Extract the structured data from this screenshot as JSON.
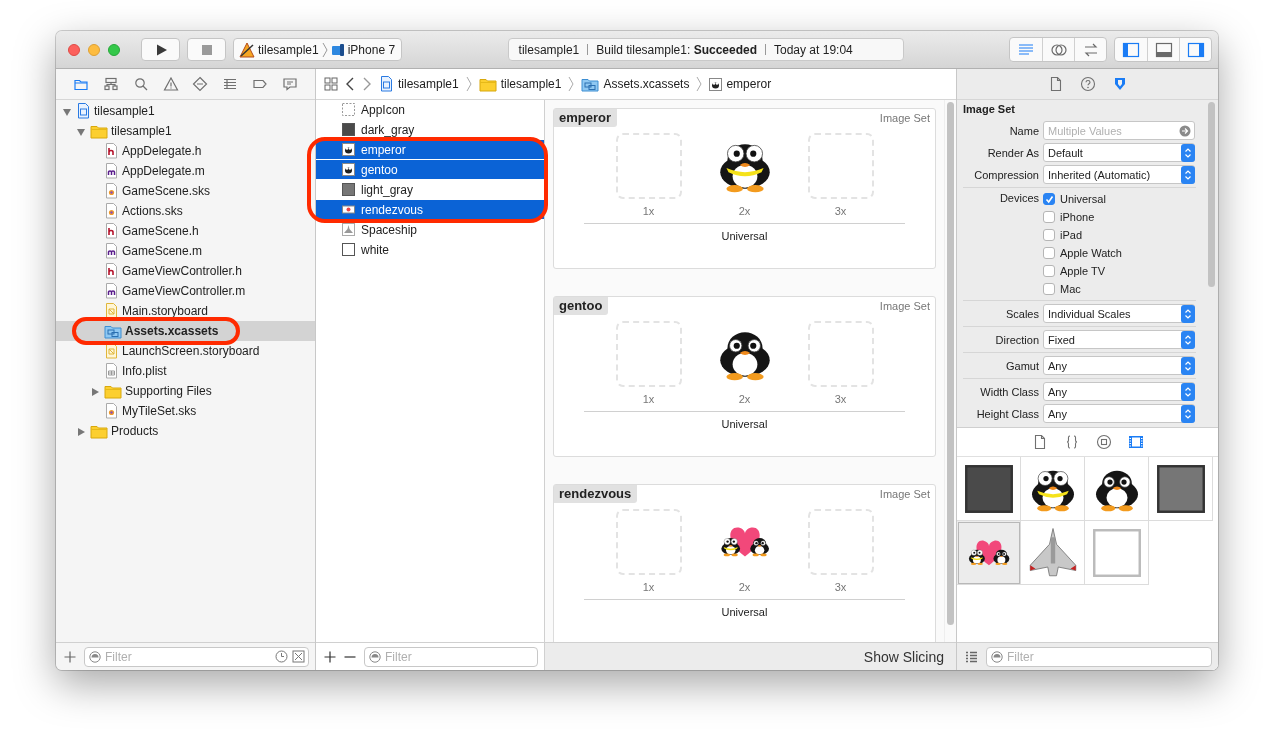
{
  "toolbar": {
    "scheme": {
      "target": "tilesample1",
      "device": "iPhone 7"
    },
    "activity": {
      "project": "tilesample1",
      "status": "Build tilesample1: **Succeeded**",
      "time": "Today at 19:04"
    },
    "editor_modes": [
      {
        "kind": "standard",
        "selected": true
      },
      {
        "kind": "assistant",
        "selected": false
      },
      {
        "kind": "version",
        "selected": false
      }
    ],
    "panels": [
      {
        "kind": "navigator",
        "on": true
      },
      {
        "kind": "debug",
        "on": false
      },
      {
        "kind": "utilities",
        "on": true
      }
    ]
  },
  "navigator": {
    "tabs": [
      {
        "kind": "project",
        "selected": true
      },
      {
        "kind": "symbol",
        "selected": false
      },
      {
        "kind": "find",
        "selected": false
      },
      {
        "kind": "issue",
        "selected": false
      },
      {
        "kind": "test",
        "selected": false
      },
      {
        "kind": "debug",
        "selected": false
      },
      {
        "kind": "breakpoint",
        "selected": false
      },
      {
        "kind": "report",
        "selected": false
      }
    ],
    "tree": [
      {
        "label": "tilesample1",
        "kind": "project",
        "expanded": true,
        "selected": false,
        "circled": false,
        "children": [
          {
            "label": "tilesample1",
            "kind": "folder",
            "expanded": true,
            "selected": false,
            "circled": false,
            "children": [
              {
                "label": "AppDelegate.h",
                "kind": "h",
                "selected": false,
                "circled": false
              },
              {
                "label": "AppDelegate.m",
                "kind": "m",
                "selected": false,
                "circled": false
              },
              {
                "label": "GameScene.sks",
                "kind": "sks",
                "selected": false,
                "circled": false
              },
              {
                "label": "Actions.sks",
                "kind": "sks",
                "selected": false,
                "circled": false
              },
              {
                "label": "GameScene.h",
                "kind": "h",
                "selected": false,
                "circled": false
              },
              {
                "label": "GameScene.m",
                "kind": "m",
                "selected": false,
                "circled": false
              },
              {
                "label": "GameViewController.h",
                "kind": "h",
                "selected": false,
                "circled": false
              },
              {
                "label": "GameViewController.m",
                "kind": "m",
                "selected": false,
                "circled": false
              },
              {
                "label": "Main.storyboard",
                "kind": "storyboard",
                "selected": false,
                "circled": false
              },
              {
                "label": "Assets.xcassets",
                "kind": "xcassets",
                "selected": true,
                "circled": true
              },
              {
                "label": "LaunchScreen.storyboard",
                "kind": "storyboard",
                "selected": false,
                "circled": false
              },
              {
                "label": "Info.plist",
                "kind": "plist",
                "selected": false,
                "circled": false
              },
              {
                "label": "Supporting Files",
                "kind": "folder",
                "expanded": false,
                "selected": false,
                "circled": false
              },
              {
                "label": "MyTileSet.sks",
                "kind": "sks",
                "selected": false,
                "circled": false
              }
            ]
          },
          {
            "label": "Products",
            "kind": "folder",
            "expanded": false,
            "selected": false,
            "circled": false
          }
        ]
      }
    ],
    "filter": {
      "placeholder": "Filter"
    }
  },
  "breadcrumb": [
    {
      "kind": "project",
      "label": "tilesample1"
    },
    {
      "kind": "folder",
      "label": "tilesample1"
    },
    {
      "kind": "xcassets",
      "label": "Assets.xcassets"
    },
    {
      "kind": "image",
      "label": "emperor"
    }
  ],
  "asset_list": {
    "items": [
      {
        "kind": "appicon",
        "label": "AppIcon",
        "selected": false,
        "circled": false
      },
      {
        "kind": "color",
        "label": "dark_gray",
        "color": "#4a4a4a",
        "selected": false,
        "circled": false
      },
      {
        "kind": "image",
        "label": "emperor",
        "selected": true,
        "circled": true
      },
      {
        "kind": "image",
        "label": "gentoo",
        "selected": true,
        "circled": true
      },
      {
        "kind": "color",
        "label": "light_gray",
        "color": "#767676",
        "selected": false,
        "circled": true
      },
      {
        "kind": "banner",
        "label": "rendezvous",
        "selected": true,
        "circled": true
      },
      {
        "kind": "sprite",
        "label": "Spaceship",
        "selected": false,
        "circled": false
      },
      {
        "kind": "blank",
        "label": "white",
        "selected": false,
        "circled": false
      }
    ],
    "filter": {
      "placeholder": "Filter"
    }
  },
  "editor": {
    "sets": [
      {
        "title": "emperor",
        "type": "Image Set",
        "kind": "emperor",
        "slots": [
          {
            "label": "1x",
            "filled": false
          },
          {
            "label": "2x",
            "filled": true
          },
          {
            "label": "3x",
            "filled": false
          }
        ],
        "device": "Universal"
      },
      {
        "title": "gentoo",
        "type": "Image Set",
        "kind": "gentoo",
        "slots": [
          {
            "label": "1x",
            "filled": false
          },
          {
            "label": "2x",
            "filled": true
          },
          {
            "label": "3x",
            "filled": false
          }
        ],
        "device": "Universal"
      },
      {
        "title": "rendezvous",
        "type": "Image Set",
        "kind": "rendezvous",
        "slots": [
          {
            "label": "1x",
            "filled": false
          },
          {
            "label": "2x",
            "filled": true
          },
          {
            "label": "3x",
            "filled": false
          }
        ],
        "device": "Universal"
      }
    ],
    "show_slicing": "Show Slicing"
  },
  "inspector": {
    "tabs": [
      {
        "kind": "file",
        "selected": false
      },
      {
        "kind": "help",
        "selected": false
      },
      {
        "kind": "attributes",
        "selected": true
      }
    ],
    "section": "Image Set",
    "groups": [
      [
        {
          "kind": "field",
          "label": "Name",
          "placeholder": "Multiple Values"
        },
        {
          "kind": "select",
          "label": "Render As",
          "value": "Default"
        },
        {
          "kind": "select",
          "label": "Compression",
          "value": "Inherited (Automatic)"
        }
      ],
      [
        {
          "kind": "checks",
          "label": "Devices",
          "options": [
            {
              "label": "Universal",
              "checked": true
            },
            {
              "label": "iPhone",
              "checked": false
            },
            {
              "label": "iPad",
              "checked": false
            },
            {
              "label": "Apple Watch",
              "checked": false
            },
            {
              "label": "Apple TV",
              "checked": false
            },
            {
              "label": "Mac",
              "checked": false
            }
          ]
        }
      ],
      [
        {
          "kind": "select",
          "label": "Scales",
          "value": "Individual Scales"
        }
      ],
      [
        {
          "kind": "select",
          "label": "Direction",
          "value": "Fixed"
        }
      ],
      [
        {
          "kind": "select",
          "label": "Gamut",
          "value": "Any"
        }
      ],
      [
        {
          "kind": "select",
          "label": "Width Class",
          "value": "Any"
        },
        {
          "kind": "select",
          "label": "Height Class",
          "value": "Any"
        }
      ]
    ]
  },
  "library": {
    "tabs": [
      {
        "kind": "file",
        "selected": false
      },
      {
        "kind": "code",
        "selected": false
      },
      {
        "kind": "object",
        "selected": false
      },
      {
        "kind": "media",
        "selected": true
      }
    ],
    "items": [
      {
        "kind": "swatch",
        "color": "#4a4a4a",
        "selected": false
      },
      {
        "kind": "emperor",
        "selected": false
      },
      {
        "kind": "gentoo",
        "selected": false
      },
      {
        "kind": "swatch",
        "color": "#767676",
        "selected": false
      },
      {
        "kind": "rendezvous",
        "selected": true
      },
      {
        "kind": "spaceship",
        "selected": false
      },
      {
        "kind": "blank",
        "selected": false
      }
    ],
    "filter": {
      "placeholder": "Filter"
    }
  }
}
